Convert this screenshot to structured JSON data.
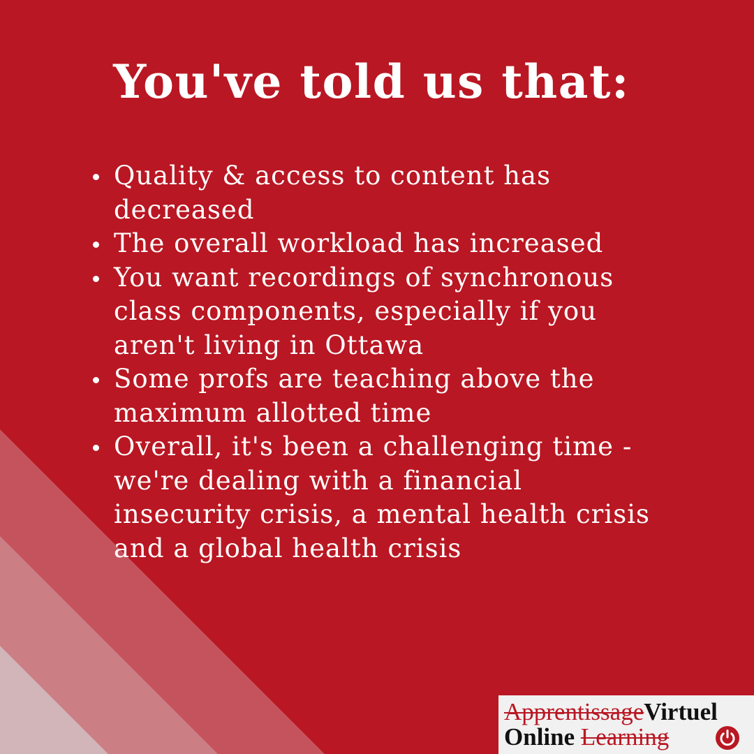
{
  "title": "You've told us that:",
  "bullets": [
    "Quality & access to content has\ndecreased",
    "The overall workload has increased",
    "You want recordings of synchronous\nclass components, especially if you\naren't living in Ottawa",
    "Some profs are teaching above the\nmaximum allotted time",
    "Overall, it's been a challenging time -\nwe're dealing with a financial\ninsecurity crisis, a mental health crisis\nand a global health crisis"
  ],
  "logo": {
    "line1_struck": "Apprentissage",
    "line1_plain": "Virtuel",
    "line2_plain": "Online",
    "line2_struck": "Learning",
    "icon": "power-icon"
  },
  "colors": {
    "background": "#b91723",
    "text": "#ffffff",
    "stripe_1": "#c5535d",
    "stripe_2": "#cb7f85",
    "stripe_3": "#d1b5b8",
    "logo_box": "#f1f1f1",
    "logo_accent": "#b91723"
  }
}
